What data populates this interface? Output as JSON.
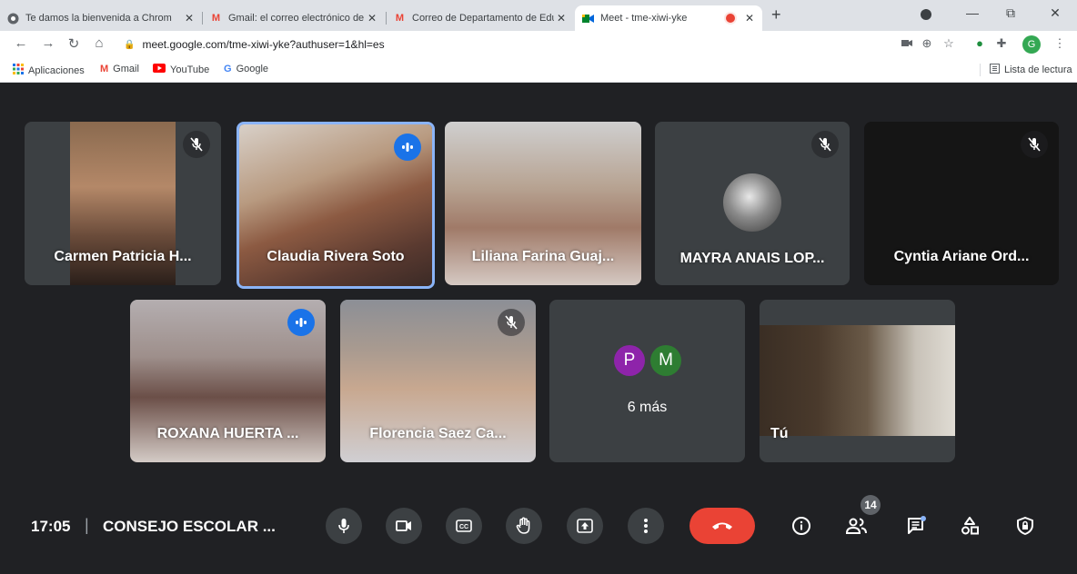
{
  "browser": {
    "tabs": [
      {
        "title": "Te damos la bienvenida a Chrom",
        "icon": "chrome-icon"
      },
      {
        "title": "Gmail: el correo electrónico de G",
        "icon": "gmail-icon"
      },
      {
        "title": "Correo de Departamento de Edu",
        "icon": "gmail-icon"
      },
      {
        "title": "Meet - tme-xiwi-yke",
        "icon": "meet-icon"
      }
    ],
    "new_tab": "+",
    "address": "meet.google.com/tme-xiwi-yke?authuser=1&hl=es",
    "profile_initial": "G",
    "bookmarks": [
      {
        "label": "Aplicaciones",
        "icon": "apps-icon"
      },
      {
        "label": "Gmail",
        "icon": "gmail-icon"
      },
      {
        "label": "YouTube",
        "icon": "youtube-icon"
      },
      {
        "label": "Google",
        "icon": "google-icon"
      }
    ],
    "reading_list": "Lista de lectura"
  },
  "meet": {
    "participants": [
      {
        "name": "Carmen Patricia H...",
        "state": "muted"
      },
      {
        "name": "Claudia Rivera Soto",
        "state": "speaking"
      },
      {
        "name": "Liliana Farina Guaj...",
        "state": "none"
      },
      {
        "name": "MAYRA ANAIS LOP...",
        "state": "muted"
      },
      {
        "name": "Cyntia Ariane Ord...",
        "state": "muted"
      },
      {
        "name": "ROXANA HUERTA ...",
        "state": "speaking"
      },
      {
        "name": "Florencia Saez Ca...",
        "state": "muted"
      },
      {
        "name": "Tú",
        "state": "none"
      }
    ],
    "more": {
      "label": "6 más",
      "avatars": [
        {
          "initial": "P",
          "color": "#8e24aa"
        },
        {
          "initial": "M",
          "color": "#2e7d32"
        }
      ]
    },
    "bottom": {
      "time": "17:05",
      "separator": "|",
      "meeting_title": "CONSEJO ESCOLAR ...",
      "participant_count": "14",
      "end_color": "#ea4335"
    }
  }
}
